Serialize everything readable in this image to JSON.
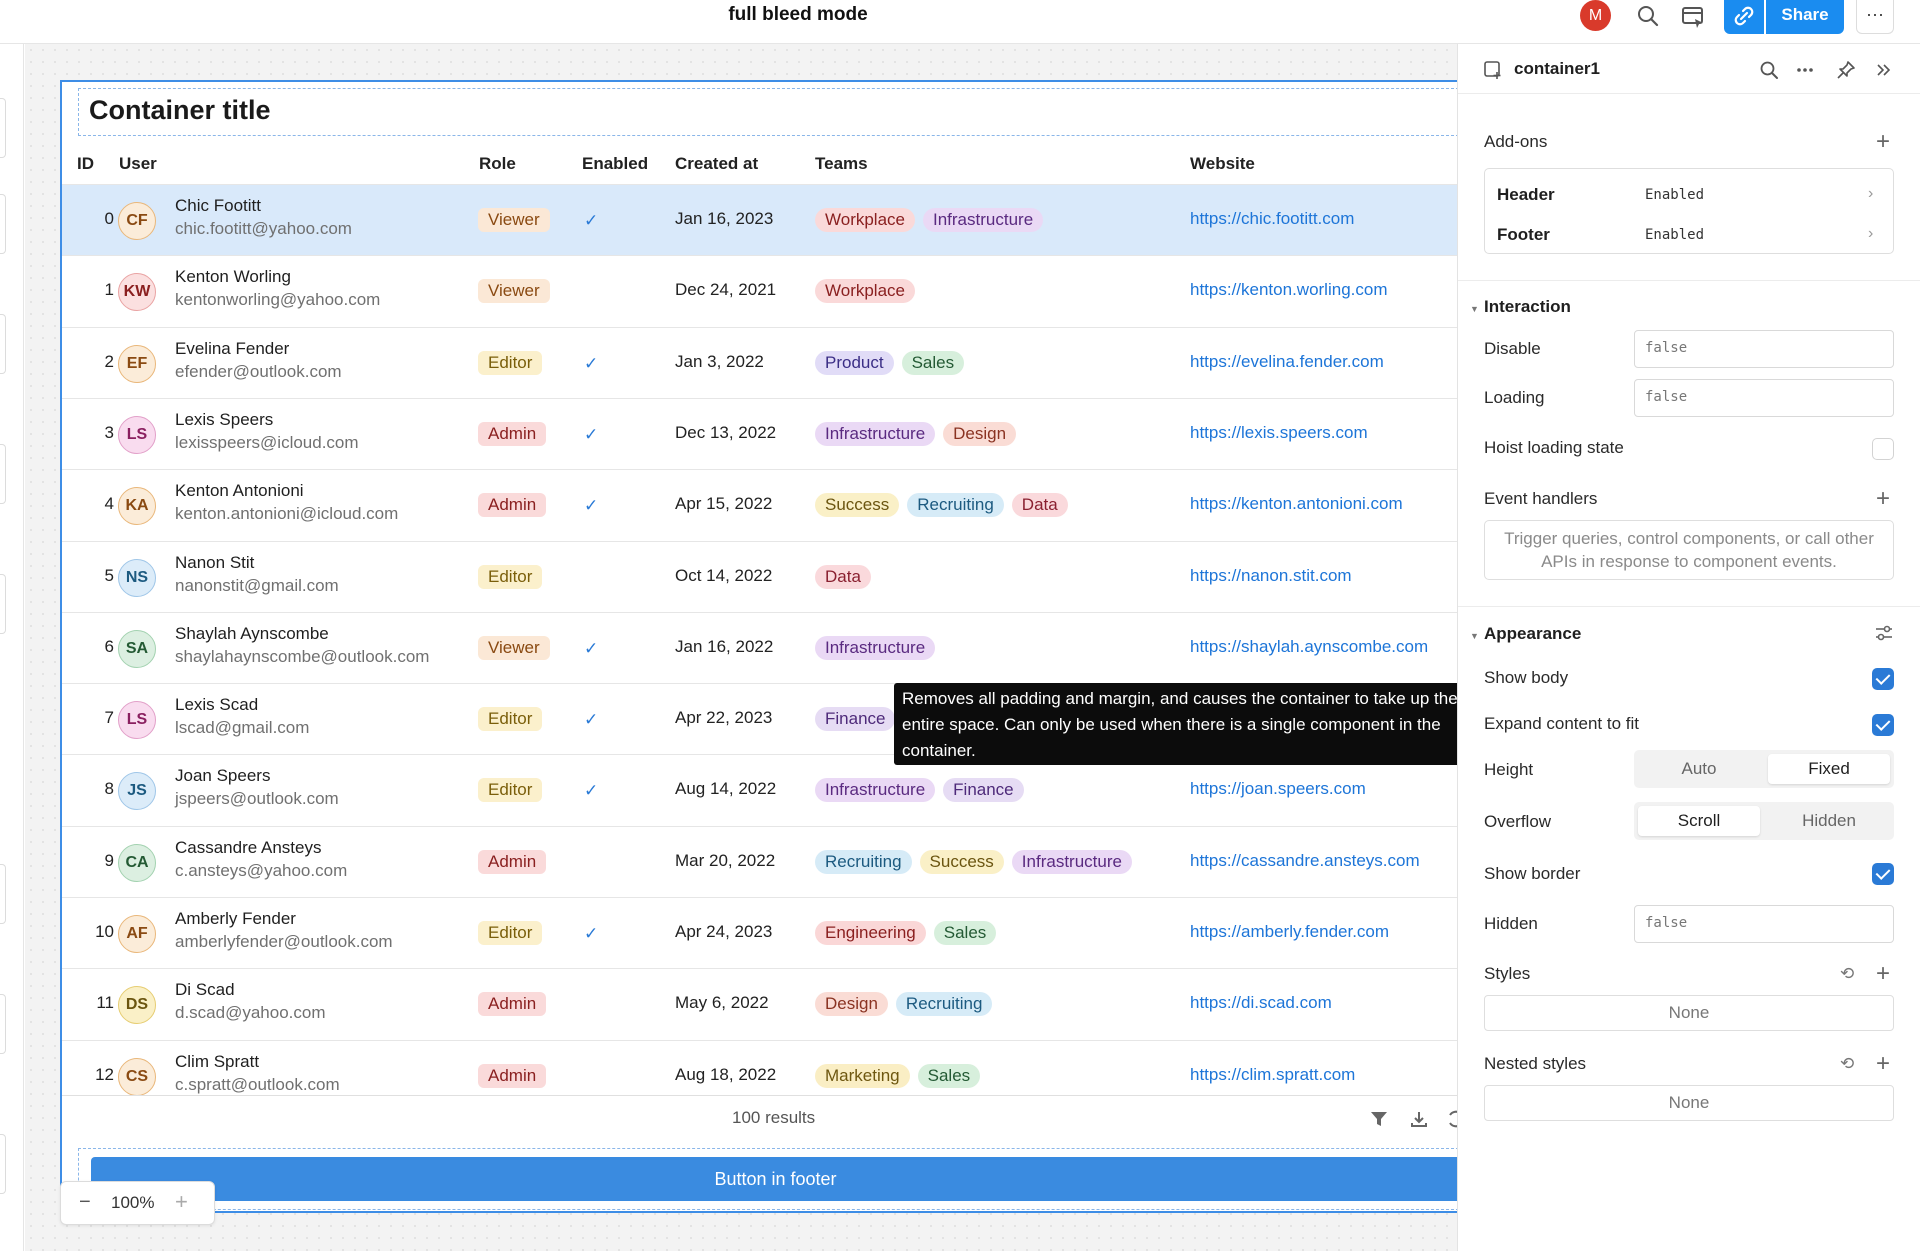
{
  "topbar": {
    "title": "full bleed mode",
    "avatar_initial": "M",
    "share_label": "Share",
    "more_label": "···"
  },
  "container": {
    "title": "Container title",
    "footer_button_label": "Button in footer",
    "results_label": "100 results"
  },
  "zoom": {
    "minus": "−",
    "level": "100%",
    "plus": "+"
  },
  "table": {
    "columns": [
      "ID",
      "User",
      "Role",
      "Enabled",
      "Created at",
      "Teams",
      "Website"
    ],
    "rows": [
      {
        "id": "0",
        "initials": "CF",
        "name": "Chic Footitt",
        "email": "chic.footitt@yahoo.com",
        "role": "Viewer",
        "enabled": "✓",
        "created": "Jan 16, 2023",
        "teams": [
          "Workplace",
          "Infrastructure"
        ],
        "website": "https://chic.footitt.com"
      },
      {
        "id": "1",
        "initials": "KW",
        "name": "Kenton Worling",
        "email": "kentonworling@yahoo.com",
        "role": "Viewer",
        "enabled": "",
        "created": "Dec 24, 2021",
        "teams": [
          "Workplace"
        ],
        "website": "https://kenton.worling.com"
      },
      {
        "id": "2",
        "initials": "EF",
        "name": "Evelina Fender",
        "email": "efender@outlook.com",
        "role": "Editor",
        "enabled": "✓",
        "created": "Jan 3, 2022",
        "teams": [
          "Product",
          "Sales"
        ],
        "website": "https://evelina.fender.com"
      },
      {
        "id": "3",
        "initials": "LS",
        "name": "Lexis Speers",
        "email": "lexisspeers@icloud.com",
        "role": "Admin",
        "enabled": "✓",
        "created": "Dec 13, 2022",
        "teams": [
          "Infrastructure",
          "Design"
        ],
        "website": "https://lexis.speers.com"
      },
      {
        "id": "4",
        "initials": "KA",
        "name": "Kenton Antonioni",
        "email": "kenton.antonioni@icloud.com",
        "role": "Admin",
        "enabled": "✓",
        "created": "Apr 15, 2022",
        "teams": [
          "Success",
          "Recruiting",
          "Data"
        ],
        "website": "https://kenton.antonioni.com"
      },
      {
        "id": "5",
        "initials": "NS",
        "name": "Nanon Stit",
        "email": "nanonstit@gmail.com",
        "role": "Editor",
        "enabled": "",
        "created": "Oct 14, 2022",
        "teams": [
          "Data"
        ],
        "website": "https://nanon.stit.com"
      },
      {
        "id": "6",
        "initials": "SA",
        "name": "Shaylah Aynscombe",
        "email": "shaylahaynscombe@outlook.com",
        "role": "Viewer",
        "enabled": "✓",
        "created": "Jan 16, 2022",
        "teams": [
          "Infrastructure"
        ],
        "website": "https://shaylah.aynscombe.com"
      },
      {
        "id": "7",
        "initials": "LS",
        "name": "Lexis Scad",
        "email": "lscad@gmail.com",
        "role": "Editor",
        "enabled": "✓",
        "created": "Apr 22, 2023",
        "teams": [
          "Finance"
        ],
        "website": ""
      },
      {
        "id": "8",
        "initials": "JS",
        "name": "Joan Speers",
        "email": "jspeers@outlook.com",
        "role": "Editor",
        "enabled": "✓",
        "created": "Aug 14, 2022",
        "teams": [
          "Infrastructure",
          "Finance"
        ],
        "website": "https://joan.speers.com"
      },
      {
        "id": "9",
        "initials": "CA",
        "name": "Cassandre Ansteys",
        "email": "c.ansteys@yahoo.com",
        "role": "Admin",
        "enabled": "",
        "created": "Mar 20, 2022",
        "teams": [
          "Recruiting",
          "Success",
          "Infrastructure"
        ],
        "website": "https://cassandre.ansteys.com"
      },
      {
        "id": "10",
        "initials": "AF",
        "name": "Amberly Fender",
        "email": "amberlyfender@outlook.com",
        "role": "Editor",
        "enabled": "✓",
        "created": "Apr 24, 2023",
        "teams": [
          "Engineering",
          "Sales"
        ],
        "website": "https://amberly.fender.com"
      },
      {
        "id": "11",
        "initials": "DS",
        "name": "Di Scad",
        "email": "d.scad@yahoo.com",
        "role": "Admin",
        "enabled": "",
        "created": "May 6, 2022",
        "teams": [
          "Design",
          "Recruiting"
        ],
        "website": "https://di.scad.com"
      },
      {
        "id": "12",
        "initials": "CS",
        "name": "Clim Spratt",
        "email": "c.spratt@outlook.com",
        "role": "Admin",
        "enabled": "",
        "created": "Aug 18, 2022",
        "teams": [
          "Marketing",
          "Sales"
        ],
        "website": "https://clim.spratt.com"
      }
    ]
  },
  "tooltip": {
    "text": "Removes all padding and margin, and causes the container to take up the entire space. Can only be used when there is a single component in the container."
  },
  "inspector": {
    "component_name": "container1",
    "addons": {
      "title": "Add-ons",
      "items": [
        {
          "name": "Header",
          "value": "Enabled"
        },
        {
          "name": "Footer",
          "value": "Enabled"
        }
      ]
    },
    "interaction": {
      "title": "Interaction",
      "disable_label": "Disable",
      "disable_value": "false",
      "loading_label": "Loading",
      "loading_value": "false",
      "hoist_label": "Hoist loading state",
      "event_handlers_label": "Event handlers",
      "event_handlers_empty": "Trigger queries, control components, or call other APIs in response to component events."
    },
    "appearance": {
      "title": "Appearance",
      "show_body_label": "Show body",
      "expand_label": "Expand content to fit",
      "height_label": "Height",
      "height_options": [
        "Auto",
        "Fixed"
      ],
      "height_selected": "Fixed",
      "overflow_label": "Overflow",
      "overflow_options": [
        "Scroll",
        "Hidden"
      ],
      "overflow_selected": "Scroll",
      "show_border_label": "Show border",
      "hidden_label": "Hidden",
      "hidden_value": "false",
      "styles_label": "Styles",
      "styles_value": "None",
      "nested_styles_label": "Nested styles",
      "nested_styles_value": "None"
    }
  },
  "colors": {
    "accent": "#1a8cf0",
    "selection": "#d9e9fa",
    "link": "#1d75d8",
    "checkbox": "#2a7ad6"
  }
}
